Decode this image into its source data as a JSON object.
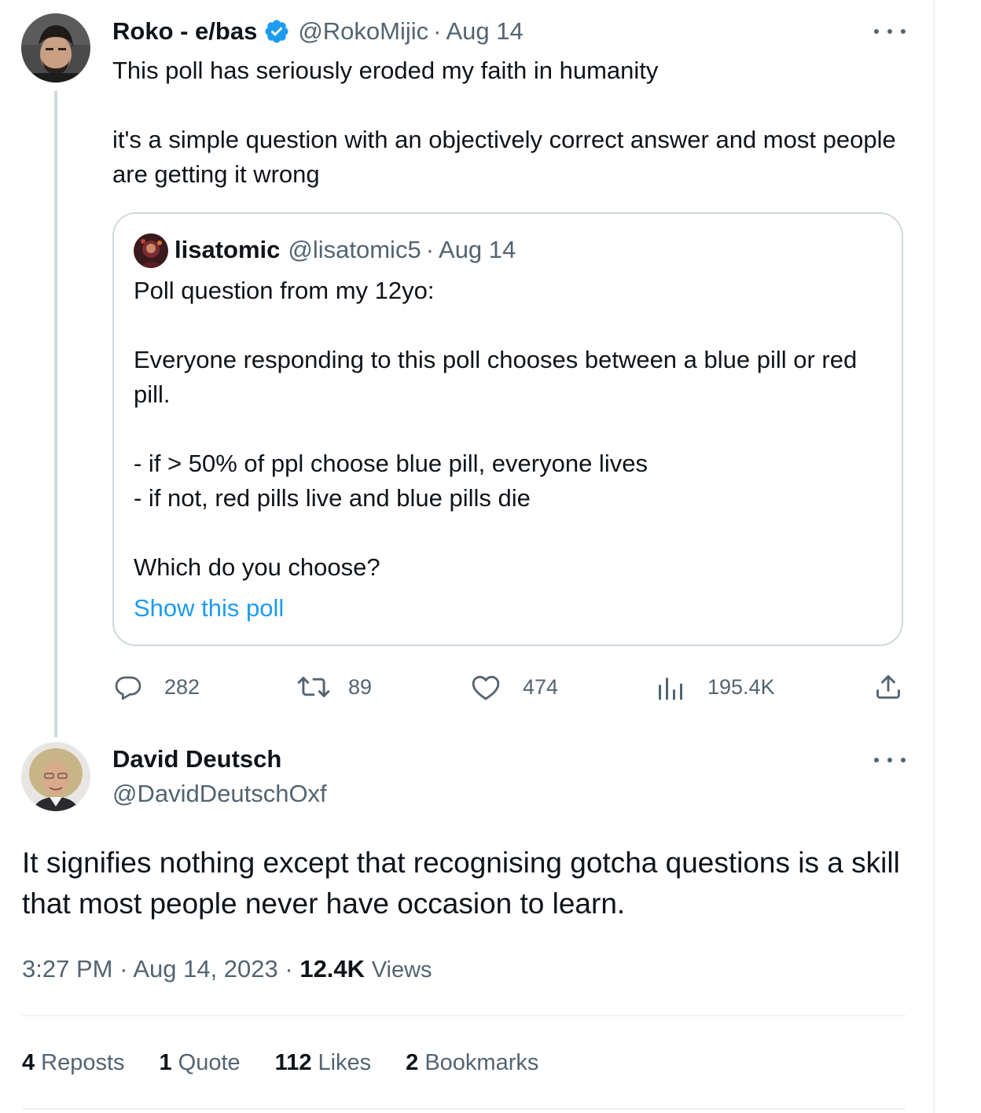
{
  "parent_tweet": {
    "name": "Roko - e/bas",
    "handle": "@RokoMijic",
    "date": "Aug 14",
    "text": "This poll has seriously eroded my faith in humanity\n\nit's a simple question with an objectively correct answer and most people are getting it wrong",
    "quote": {
      "name": "lisatomic",
      "handle": "@lisatomic5",
      "date": "Aug 14",
      "text": "Poll question from my 12yo:\n\nEveryone responding to this poll chooses between a blue pill or red pill.\n\n- if > 50% of ppl choose blue pill, everyone lives\n- if not, red pills live and blue pills die\n\nWhich do you choose?",
      "show_poll_label": "Show this poll"
    },
    "actions": {
      "replies": "282",
      "reposts": "89",
      "likes": "474",
      "views": "195.4K"
    }
  },
  "main_tweet": {
    "name": "David Deutsch",
    "handle": "@DavidDeutschOxf",
    "text": "It signifies nothing except that recognising gotcha questions is a skill that most people never have occasion to learn.",
    "time": "3:27 PM",
    "date": "Aug 14, 2023",
    "views_count": "12.4K",
    "views_label": "Views",
    "stats": {
      "reposts_count": "4",
      "reposts_label": "Reposts",
      "quotes_count": "1",
      "quotes_label": "Quote",
      "likes_count": "112",
      "likes_label": "Likes",
      "bookmarks_count": "2",
      "bookmarks_label": "Bookmarks"
    }
  },
  "icons": {
    "verified": "verified-badge-icon",
    "more": "more-horizontal-icon",
    "reply": "reply-icon",
    "repost": "repost-icon",
    "like": "heart-icon",
    "views": "views-chart-icon",
    "share": "share-icon"
  },
  "colors": {
    "text": "#0f1419",
    "secondary": "#536471",
    "accent": "#1d9bf0",
    "border": "#cfd9de"
  }
}
